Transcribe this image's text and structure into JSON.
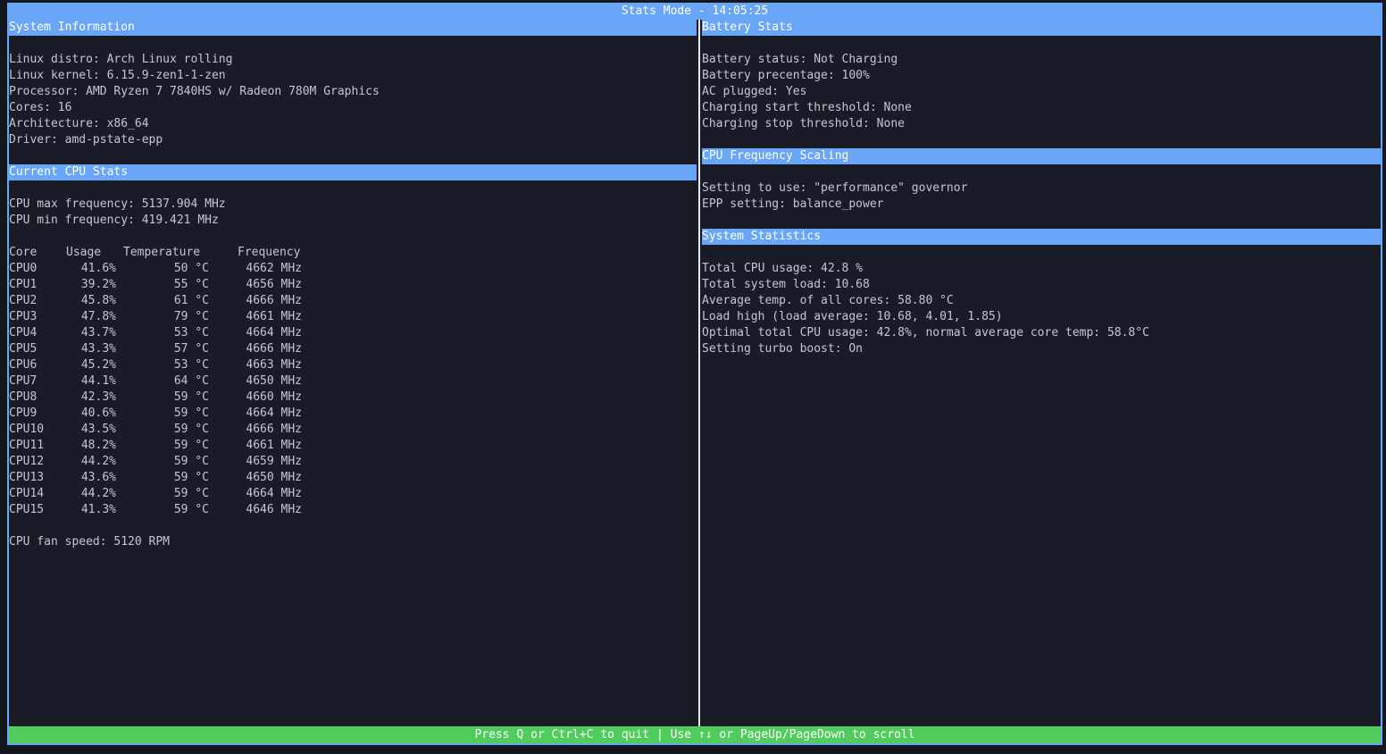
{
  "title": "Stats Mode - 14:05:25",
  "system_info": {
    "header": "System Information",
    "lines": [
      "Linux distro: Arch Linux rolling",
      "Linux kernel: 6.15.9-zen1-1-zen",
      "Processor: AMD Ryzen 7 7840HS w/ Radeon 780M Graphics",
      "Cores: 16",
      "Architecture: x86_64",
      "Driver: amd-pstate-epp"
    ]
  },
  "cpu_stats": {
    "header": "Current CPU Stats",
    "max_freq": "CPU max frequency: 5137.904 MHz",
    "min_freq": "CPU min frequency: 419.421 MHz",
    "columns": [
      "Core",
      "Usage",
      "Temperature",
      "Frequency"
    ],
    "rows": [
      [
        "CPU0",
        "41.6%",
        "50 °C",
        "4662 MHz"
      ],
      [
        "CPU1",
        "39.2%",
        "55 °C",
        "4656 MHz"
      ],
      [
        "CPU2",
        "45.8%",
        "61 °C",
        "4666 MHz"
      ],
      [
        "CPU3",
        "47.8%",
        "79 °C",
        "4661 MHz"
      ],
      [
        "CPU4",
        "43.7%",
        "53 °C",
        "4664 MHz"
      ],
      [
        "CPU5",
        "43.3%",
        "57 °C",
        "4666 MHz"
      ],
      [
        "CPU6",
        "45.2%",
        "53 °C",
        "4663 MHz"
      ],
      [
        "CPU7",
        "44.1%",
        "64 °C",
        "4650 MHz"
      ],
      [
        "CPU8",
        "42.3%",
        "59 °C",
        "4660 MHz"
      ],
      [
        "CPU9",
        "40.6%",
        "59 °C",
        "4664 MHz"
      ],
      [
        "CPU10",
        "43.5%",
        "59 °C",
        "4666 MHz"
      ],
      [
        "CPU11",
        "48.2%",
        "59 °C",
        "4661 MHz"
      ],
      [
        "CPU12",
        "44.2%",
        "59 °C",
        "4659 MHz"
      ],
      [
        "CPU13",
        "43.6%",
        "59 °C",
        "4650 MHz"
      ],
      [
        "CPU14",
        "44.2%",
        "59 °C",
        "4664 MHz"
      ],
      [
        "CPU15",
        "41.3%",
        "59 °C",
        "4646 MHz"
      ]
    ],
    "fan_speed": "CPU fan speed: 5120 RPM"
  },
  "battery": {
    "header": "Battery Stats",
    "lines": [
      "Battery status: Not Charging",
      "Battery precentage: 100%",
      "AC plugged: Yes",
      "Charging start threshold: None",
      "Charging stop threshold: None"
    ]
  },
  "scaling": {
    "header": "CPU Frequency Scaling",
    "lines": [
      "Setting to use: \"performance\" governor",
      "EPP setting: balance_power"
    ]
  },
  "statistics": {
    "header": "System Statistics",
    "lines": [
      "Total CPU usage: 42.8 %",
      "Total system load: 10.68",
      "Average temp. of all cores: 58.80 °C",
      "Load high (load average: 10.68, 4.01, 1.85)",
      "Optimal total CPU usage: 42.8%, normal average core temp: 58.8°C",
      "Setting turbo boost: On"
    ]
  },
  "footer": "Press Q or Ctrl+C to quit | Use ↑↓ or PageUp/PageDown to scroll"
}
